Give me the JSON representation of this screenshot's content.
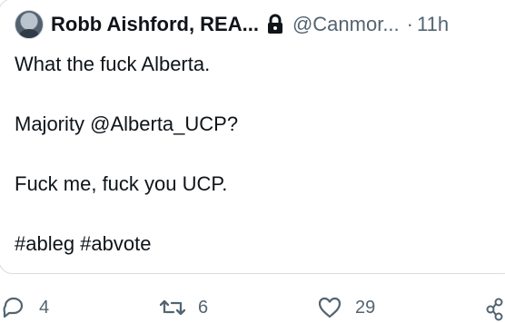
{
  "tweet": {
    "author_name": "Robb Aishford, REA...",
    "handle": "@Canmor...",
    "separator": "·",
    "time": "11h",
    "lines": [
      "What the fuck Alberta.",
      "Majority @Alberta_UCP?",
      "Fuck me, fuck you UCP.",
      "#ableg #abvote"
    ]
  },
  "actions": {
    "reply_count": "4",
    "retweet_count": "6",
    "like_count": "29"
  },
  "icons": {
    "lock": "lock-icon",
    "reply": "reply-icon",
    "retweet": "retweet-icon",
    "like": "heart-icon",
    "share": "share-icon"
  },
  "colors": {
    "text": "#0f1419",
    "muted": "#536471",
    "border": "#d7dde2"
  }
}
